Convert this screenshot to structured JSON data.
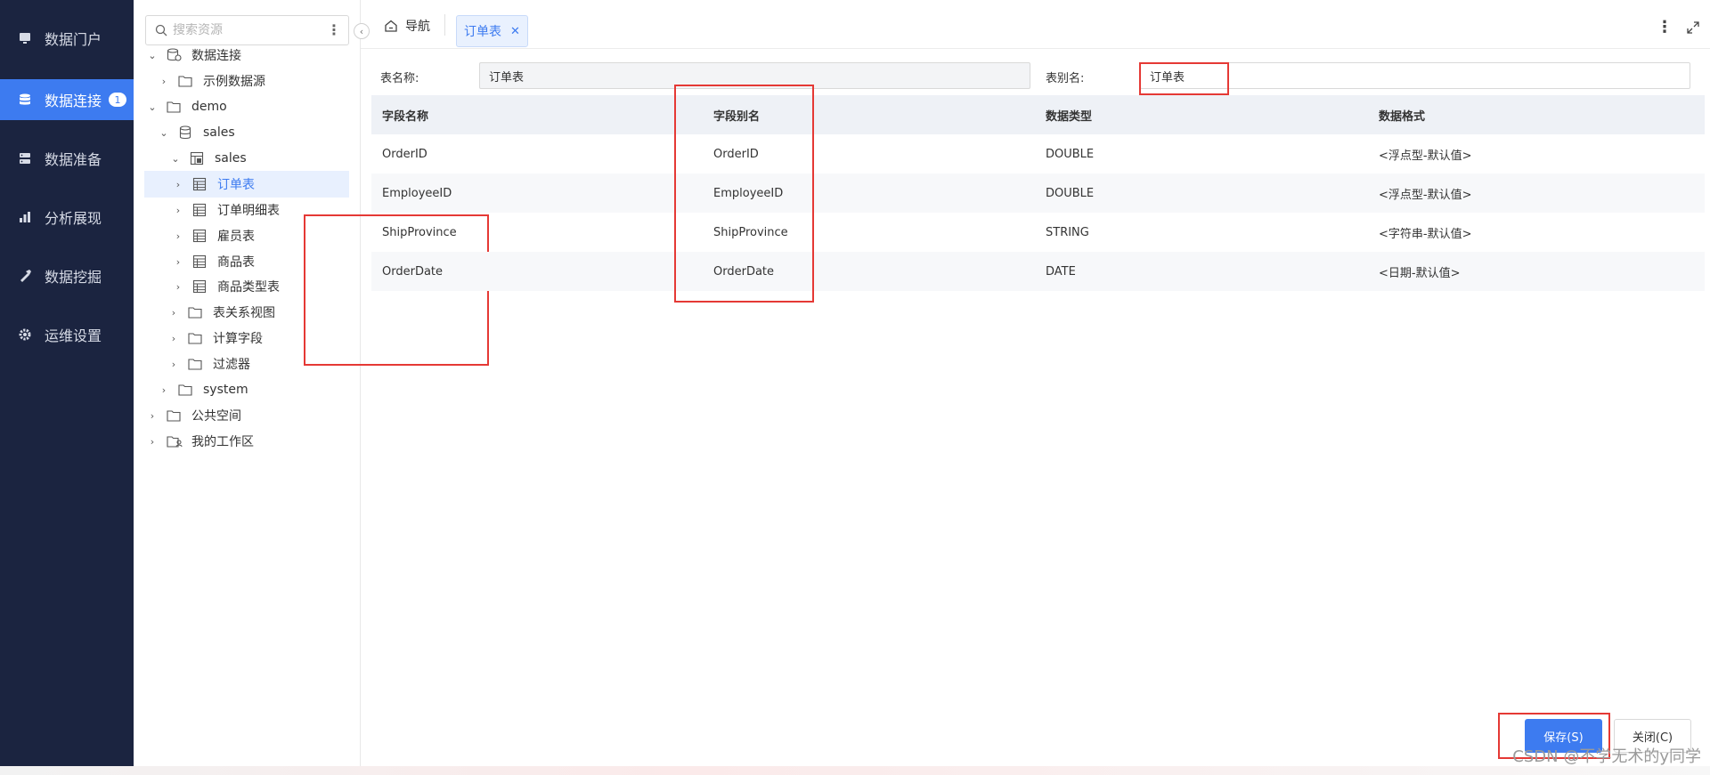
{
  "nav": {
    "items": [
      {
        "label": "数据门户",
        "icon": "monitor-icon",
        "active": false
      },
      {
        "label": "数据连接",
        "icon": "database-icon",
        "active": true,
        "badge": "1"
      },
      {
        "label": "数据准备",
        "icon": "server-icon",
        "active": false
      },
      {
        "label": "分析展现",
        "icon": "bar-chart-icon",
        "active": false
      },
      {
        "label": "数据挖掘",
        "icon": "pickaxe-icon",
        "active": false
      },
      {
        "label": "运维设置",
        "icon": "gear-icon",
        "active": false
      }
    ]
  },
  "tree": {
    "search_placeholder": "搜索资源",
    "nodes": [
      {
        "label": "数据连接",
        "icon": "data-connection-icon",
        "expanded": true
      },
      {
        "label": "示例数据源",
        "icon": "folder-icon",
        "expanded": false
      },
      {
        "label": "demo",
        "icon": "folder-icon",
        "expanded": true
      },
      {
        "label": "sales",
        "icon": "database-icon",
        "expanded": true
      },
      {
        "label": "sales",
        "icon": "schema-icon",
        "expanded": true
      },
      {
        "label": "订单表",
        "icon": "table-icon",
        "expanded": false,
        "selected": true
      },
      {
        "label": "订单明细表",
        "icon": "table-icon",
        "expanded": false
      },
      {
        "label": "雇员表",
        "icon": "table-icon",
        "expanded": false
      },
      {
        "label": "商品表",
        "icon": "table-icon",
        "expanded": false
      },
      {
        "label": "商品类型表",
        "icon": "table-icon",
        "expanded": false
      },
      {
        "label": "表关系视图",
        "icon": "folder-icon",
        "expanded": false
      },
      {
        "label": "计算字段",
        "icon": "folder-icon",
        "expanded": false
      },
      {
        "label": "过滤器",
        "icon": "folder-icon",
        "expanded": false
      },
      {
        "label": "system",
        "icon": "folder-icon",
        "expanded": false
      },
      {
        "label": "公共空间",
        "icon": "folder-icon",
        "expanded": false
      },
      {
        "label": "我的工作区",
        "icon": "user-folder-icon",
        "expanded": false
      }
    ]
  },
  "tabs": {
    "home_label": "导航",
    "active_label": "订单表"
  },
  "form": {
    "table_name_label": "表名称:",
    "table_name_value": "订单表",
    "table_alias_label": "表别名:",
    "table_alias_value": "订单表"
  },
  "grid": {
    "headers": [
      "字段名称",
      "字段别名",
      "数据类型",
      "数据格式"
    ],
    "rows": [
      [
        "OrderID",
        "OrderID",
        "DOUBLE",
        "<浮点型-默认值>"
      ],
      [
        "EmployeeID",
        "EmployeeID",
        "DOUBLE",
        "<浮点型-默认值>"
      ],
      [
        "ShipProvince",
        "ShipProvince",
        "STRING",
        "<字符串-默认值>"
      ],
      [
        "OrderDate",
        "OrderDate",
        "DATE",
        "<日期-默认值>"
      ]
    ]
  },
  "buttons": {
    "save_label": "保存(S)",
    "close_label": "关闭(C)"
  },
  "watermark": "CSDN @不学无术的y同学",
  "colors": {
    "nav_bg": "#1b2440",
    "accent": "#3d7bf0",
    "highlight_box": "#e53935"
  }
}
